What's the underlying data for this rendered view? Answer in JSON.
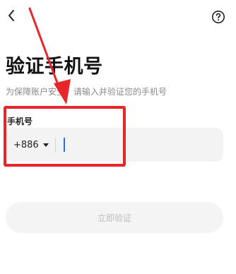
{
  "header": {
    "back_icon": "chevron-left-icon",
    "help_icon": "question-circle-icon"
  },
  "page": {
    "title": "验证手机号",
    "subtitle": "为保障账户安全，请输入并验证您的手机号"
  },
  "phone_field": {
    "label": "手机号",
    "country_code": "+886",
    "country_dropdown_icon": "triangle-down-icon",
    "value": "",
    "placeholder": ""
  },
  "verify_button": {
    "label": "立即验证",
    "state": "disabled"
  },
  "annotation": {
    "color": "#e8262a",
    "shapes": [
      "arrow",
      "rectangle"
    ]
  }
}
